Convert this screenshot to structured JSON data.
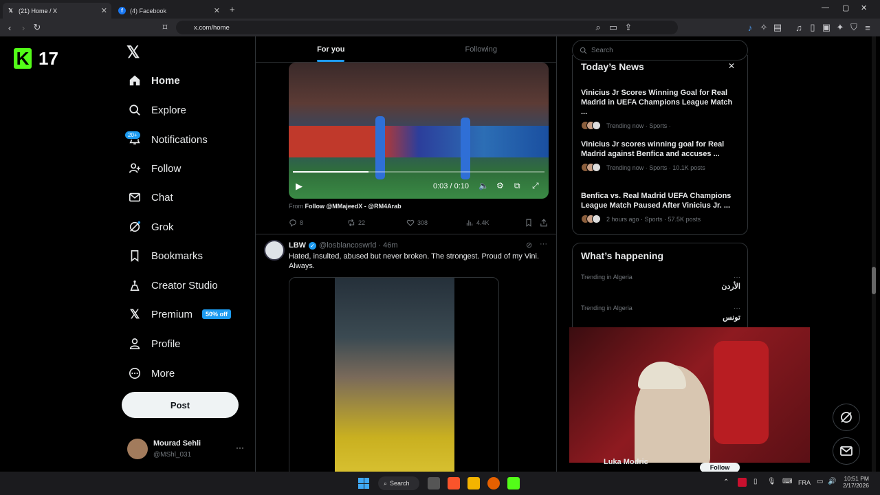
{
  "browser": {
    "tabs": [
      {
        "title": "(21) Home / X",
        "icon": "x-logo-icon",
        "active": true
      },
      {
        "title": "(4) Facebook",
        "icon": "facebook-icon",
        "active": false
      }
    ],
    "url": "x.com/home"
  },
  "overlay": {
    "channel_logo": "K",
    "channel_number": "17"
  },
  "nav": {
    "items": [
      {
        "label": "Home",
        "icon": "home-icon"
      },
      {
        "label": "Explore",
        "icon": "search-icon"
      },
      {
        "label": "Notifications",
        "icon": "bell-icon",
        "badge": "20+"
      },
      {
        "label": "Follow",
        "icon": "follow-icon"
      },
      {
        "label": "Chat",
        "icon": "mail-icon"
      },
      {
        "label": "Grok",
        "icon": "grok-icon"
      },
      {
        "label": "Bookmarks",
        "icon": "bookmark-icon"
      },
      {
        "label": "Creator Studio",
        "icon": "creator-icon"
      },
      {
        "label": "Premium",
        "icon": "x-logo-icon",
        "badge": "50% off"
      },
      {
        "label": "Profile",
        "icon": "person-icon"
      },
      {
        "label": "More",
        "icon": "more-icon"
      }
    ],
    "post_label": "Post",
    "account": {
      "name": "Mourad Sehli",
      "handle": "@MShl_031"
    }
  },
  "feed": {
    "tabs": [
      "For you",
      "Following"
    ],
    "video_post": {
      "video_time": "0:03 / 0:10",
      "from_label": "From",
      "from_text": "Follow @MMajeedX - @RM4Arab",
      "replies": "8",
      "reposts": "22",
      "likes": "308",
      "views": "4.4K"
    },
    "post2": {
      "name": "LBW",
      "handle": "@losblancoswrld",
      "time": "· 46m",
      "text": "Hated, insulted, abused but never broken. The strongest. Proud of my Vini. Always."
    }
  },
  "sidebar": {
    "search_placeholder": "Search",
    "news_title": "Today’s News",
    "news": [
      {
        "title": "Vinicius Jr Scores Winning Goal for Real Madrid in UEFA Champions League Match ...",
        "meta": "Trending now · Sports ·"
      },
      {
        "title": "Vinicius Jr scores winning goal for Real Madrid against Benfica and accuses ...",
        "meta": "Trending now · Sports · 10.1K posts"
      },
      {
        "title": "Benfica vs. Real Madrid UEFA Champions League Match Paused After Vinicius Jr. ...",
        "meta": "2 hours ago · Sports · 57.5K posts"
      }
    ],
    "happening_title": "What’s happening",
    "trends": [
      {
        "context": "Trending in Algeria",
        "name": "الأردن"
      },
      {
        "context": "Trending in Algeria",
        "name": "تونس"
      }
    ],
    "suggest_name": "Luka Modric",
    "follow_label": "Follow"
  },
  "taskbar": {
    "search_label": "Search",
    "lang": "FRA",
    "time": "10:51 PM",
    "date": "2/17/2026"
  },
  "colors": {
    "accent": "#1d9bf0",
    "kick_green": "#53fc18",
    "background": "#000000"
  }
}
